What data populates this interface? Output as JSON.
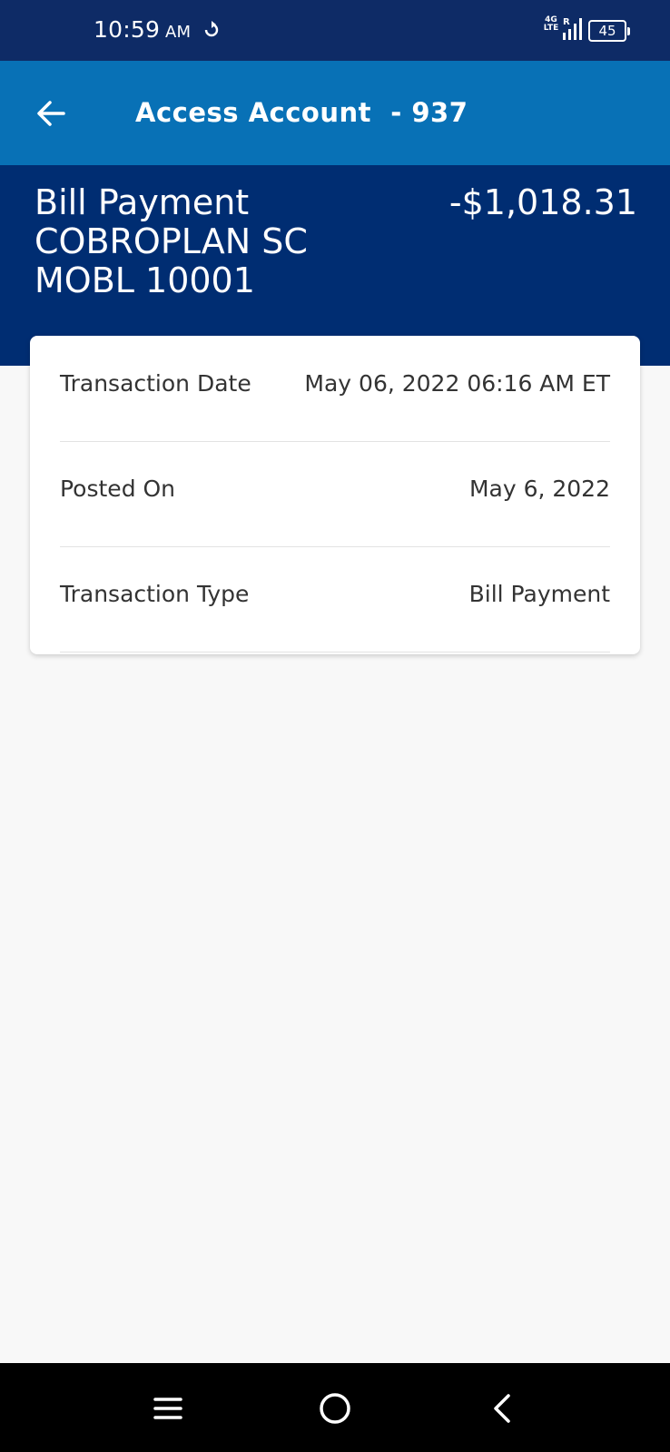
{
  "status_bar": {
    "time": "10:59",
    "ampm": "AM",
    "network_top": "4G",
    "network_bottom": "LTE",
    "roaming": "R",
    "battery_level": "45",
    "icons": [
      "sync-icon",
      "signal-icon",
      "battery-icon"
    ]
  },
  "header": {
    "title": "Access Account  - 937",
    "back_icon": "arrow-left-icon"
  },
  "transaction": {
    "payee_lines": [
      "Bill Payment",
      "COBROPLAN SC",
      "MOBL 10001"
    ],
    "amount": "-$1,018.31"
  },
  "details": [
    {
      "label": "Transaction Date",
      "value": "May 06, 2022 06:16 AM ET"
    },
    {
      "label": "Posted On",
      "value": "May 6, 2022"
    },
    {
      "label": "Transaction Type",
      "value": "Bill Payment"
    }
  ],
  "nav_bar": {
    "icons": [
      "menu-icon",
      "home-circle-icon",
      "back-chevron-icon"
    ]
  },
  "colors": {
    "status_bar": "#0e2b66",
    "header": "#0871b6",
    "summary": "#002d72",
    "background": "#f8f8f8"
  }
}
